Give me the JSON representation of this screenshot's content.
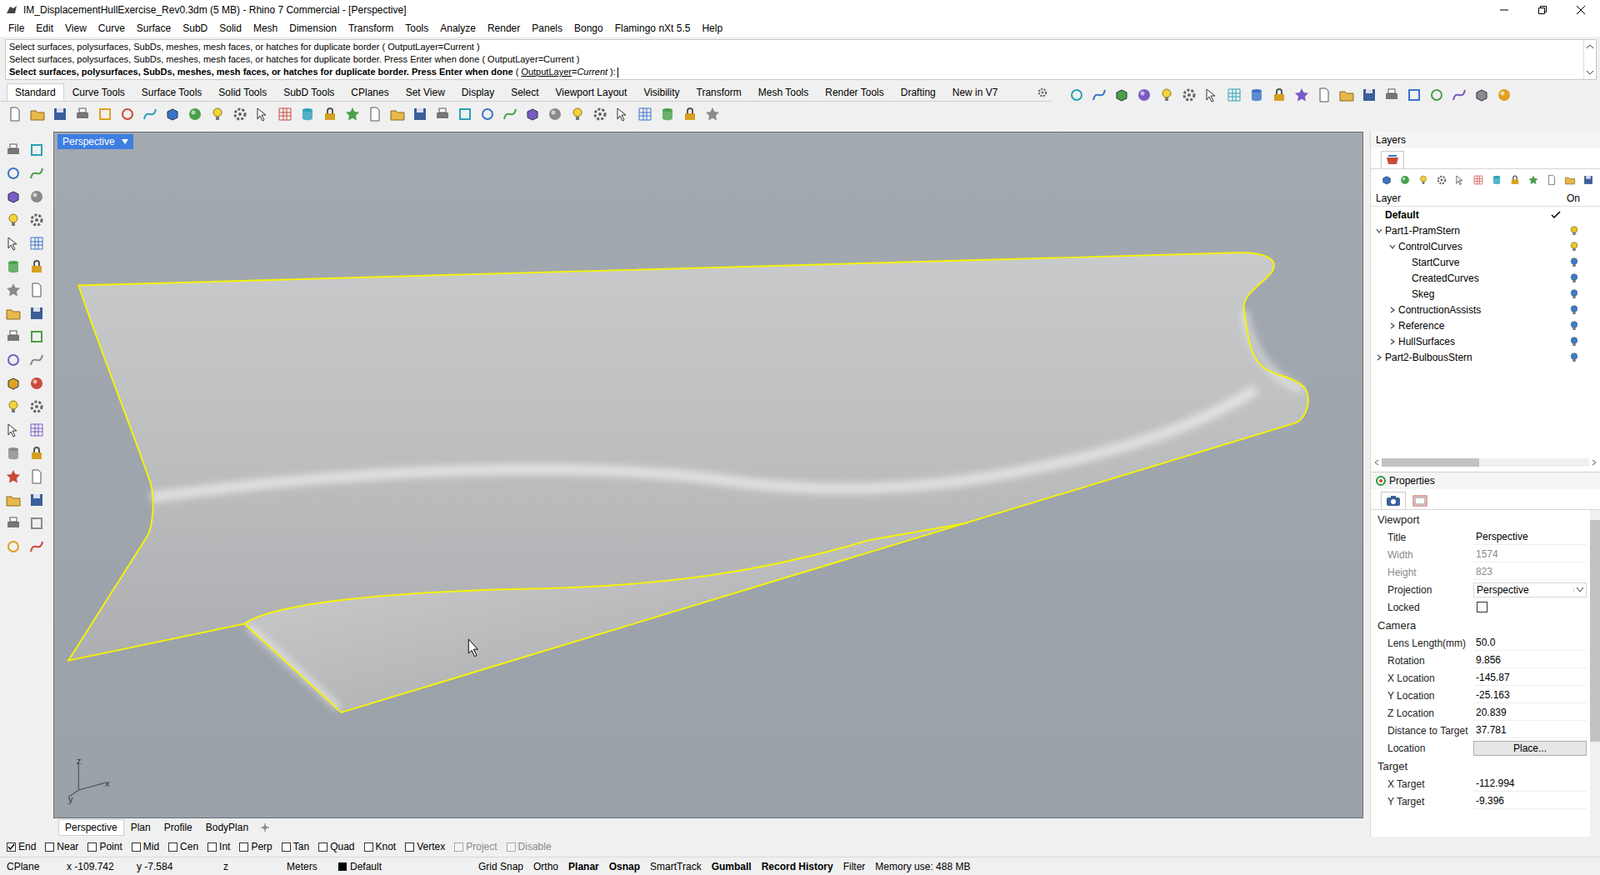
{
  "window": {
    "title": "IM_DisplacementHullExercise_Rev0.3dm (5 MB) - Rhino 7 Commercial - [Perspective]"
  },
  "menu": [
    "File",
    "Edit",
    "View",
    "Curve",
    "Surface",
    "SubD",
    "Solid",
    "Mesh",
    "Dimension",
    "Transform",
    "Tools",
    "Analyze",
    "Render",
    "Panels",
    "Bongo",
    "Flamingo nXt 5.5",
    "Help"
  ],
  "command": {
    "history": [
      "Select surfaces, polysurfaces, SubDs, meshes, mesh faces, or hatches for duplicate border ( OutputLayer=Current )",
      "Select surfaces, polysurfaces, SubDs, meshes, mesh faces, or hatches for duplicate border. Press Enter when done ( OutputLayer=Current )"
    ],
    "prompt": "Select surfaces, polysurfaces, SubDs, meshes, mesh faces, or hatches for duplicate border. Press Enter when done",
    "open": " ( ",
    "option": "OutputLayer",
    "equals": "=",
    "value": "Current",
    "close": " ):"
  },
  "toolbar_tabs": [
    {
      "label": "Standard",
      "selected": true
    },
    {
      "label": "Curve Tools",
      "selected": false
    },
    {
      "label": "Surface Tools",
      "selected": false
    },
    {
      "label": "Solid Tools",
      "selected": false
    },
    {
      "label": "SubD Tools",
      "selected": false
    },
    {
      "label": "CPlanes",
      "selected": false
    },
    {
      "label": "Set View",
      "selected": false
    },
    {
      "label": "Display",
      "selected": false
    },
    {
      "label": "Select",
      "selected": false
    },
    {
      "label": "Viewport Layout",
      "selected": false
    },
    {
      "label": "Visibility",
      "selected": false
    },
    {
      "label": "Transform",
      "selected": false
    },
    {
      "label": "Mesh Tools",
      "selected": false
    },
    {
      "label": "Render Tools",
      "selected": false
    },
    {
      "label": "Drafting",
      "selected": false
    },
    {
      "label": "New in V7",
      "selected": false
    }
  ],
  "viewport": {
    "label": "Perspective",
    "axes": {
      "x": "x",
      "y": "y",
      "z": "z"
    }
  },
  "viewport_tabs": [
    {
      "label": "Perspective",
      "selected": true
    },
    {
      "label": "Plan",
      "selected": false
    },
    {
      "label": "Profile",
      "selected": false
    },
    {
      "label": "BodyPlan",
      "selected": false
    }
  ],
  "osnaps": [
    {
      "label": "End",
      "checked": true,
      "disabled": false
    },
    {
      "label": "Near",
      "checked": false,
      "disabled": false
    },
    {
      "label": "Point",
      "checked": false,
      "disabled": false
    },
    {
      "label": "Mid",
      "checked": false,
      "disabled": false
    },
    {
      "label": "Cen",
      "checked": false,
      "disabled": false
    },
    {
      "label": "Int",
      "checked": false,
      "disabled": false
    },
    {
      "label": "Perp",
      "checked": false,
      "disabled": false
    },
    {
      "label": "Tan",
      "checked": false,
      "disabled": false
    },
    {
      "label": "Quad",
      "checked": false,
      "disabled": false
    },
    {
      "label": "Knot",
      "checked": false,
      "disabled": false
    },
    {
      "label": "Vertex",
      "checked": false,
      "disabled": false
    },
    {
      "label": "Project",
      "checked": false,
      "disabled": true
    },
    {
      "label": "Disable",
      "checked": false,
      "disabled": true
    }
  ],
  "status_bar": {
    "cplane": "CPlane",
    "x": "x -109.742",
    "y": "y -7.584",
    "z": "z",
    "units": "Meters",
    "layer": {
      "name": "Default",
      "color": "#000000"
    },
    "toggles": [
      {
        "label": "Grid Snap",
        "on": false
      },
      {
        "label": "Ortho",
        "on": false
      },
      {
        "label": "Planar",
        "on": true
      },
      {
        "label": "Osnap",
        "on": true
      },
      {
        "label": "SmartTrack",
        "on": false
      },
      {
        "label": "Gumball",
        "on": true
      },
      {
        "label": "Record History",
        "on": true
      },
      {
        "label": "Filter",
        "on": false
      }
    ],
    "memory": "Memory use: 488 MB"
  },
  "layers_panel": {
    "title": "Layers",
    "columns": [
      "Layer",
      "On"
    ],
    "hscroll": 0.47,
    "layers": [
      {
        "name": "Default",
        "depth": 0,
        "expandable": false,
        "expanded": false,
        "current": true,
        "bulb": false
      },
      {
        "name": "Part1-PramStern",
        "depth": 0,
        "expandable": true,
        "expanded": true,
        "current": false,
        "bulb": true,
        "color": "#f2c618"
      },
      {
        "name": "ControlCurves",
        "depth": 1,
        "expandable": true,
        "expanded": true,
        "current": false,
        "bulb": true,
        "color": "#f2c618"
      },
      {
        "name": "StartCurve",
        "depth": 2,
        "expandable": false,
        "expanded": false,
        "current": false,
        "bulb": true,
        "color": "#3a7bd5"
      },
      {
        "name": "CreatedCurves",
        "depth": 2,
        "expandable": false,
        "expanded": false,
        "current": false,
        "bulb": true,
        "color": "#3a7bd5"
      },
      {
        "name": "Skeg",
        "depth": 2,
        "expandable": false,
        "expanded": false,
        "current": false,
        "bulb": true,
        "color": "#3a7bd5"
      },
      {
        "name": "ContructionAssists",
        "depth": 1,
        "expandable": true,
        "expanded": false,
        "current": false,
        "bulb": true,
        "color": "#3a7bd5"
      },
      {
        "name": "Reference",
        "depth": 1,
        "expandable": true,
        "expanded": false,
        "current": false,
        "bulb": true,
        "color": "#3a7bd5"
      },
      {
        "name": "HullSurfaces",
        "depth": 1,
        "expandable": true,
        "expanded": false,
        "current": false,
        "bulb": true,
        "color": "#3a7bd5"
      },
      {
        "name": "Part2-BulbousStern",
        "depth": 0,
        "expandable": true,
        "expanded": false,
        "current": false,
        "bulb": true,
        "color": "#3a7bd5"
      }
    ]
  },
  "properties_panel": {
    "title": "Properties",
    "page_tabs": [
      {
        "selected": true
      },
      {
        "selected": false
      }
    ],
    "scroll": 0.7,
    "sections": [
      {
        "title": "Viewport",
        "rows": [
          {
            "label": "Title",
            "kind": "text",
            "value": "Perspective",
            "disabled": false
          },
          {
            "label": "Width",
            "kind": "text",
            "value": "1574",
            "disabled": true
          },
          {
            "label": "Height",
            "kind": "text",
            "value": "823",
            "disabled": true
          },
          {
            "label": "Projection",
            "kind": "dropdown",
            "value": "Perspective",
            "disabled": false
          },
          {
            "label": "Locked",
            "kind": "checkbox",
            "checked": false,
            "disabled": false
          }
        ]
      },
      {
        "title": "Camera",
        "rows": [
          {
            "label": "Lens Length(mm)",
            "kind": "text",
            "value": "50.0",
            "disabled": false
          },
          {
            "label": "Rotation",
            "kind": "text",
            "value": "9.856",
            "disabled": false
          },
          {
            "label": "X Location",
            "kind": "text",
            "value": "-145.87",
            "disabled": false
          },
          {
            "label": "Y Location",
            "kind": "text",
            "value": "-25.163",
            "disabled": false
          },
          {
            "label": "Z Location",
            "kind": "text",
            "value": "20.839",
            "disabled": false
          },
          {
            "label": "Distance to Target",
            "kind": "text",
            "value": "37.781",
            "disabled": false
          },
          {
            "label": "Location",
            "kind": "button",
            "value": "Place...",
            "disabled": false
          }
        ]
      },
      {
        "title": "Target",
        "rows": [
          {
            "label": "X Target",
            "kind": "text",
            "value": "-112.994",
            "disabled": false
          },
          {
            "label": "Y Target",
            "kind": "text",
            "value": "-9.396",
            "disabled": false
          }
        ]
      }
    ]
  }
}
